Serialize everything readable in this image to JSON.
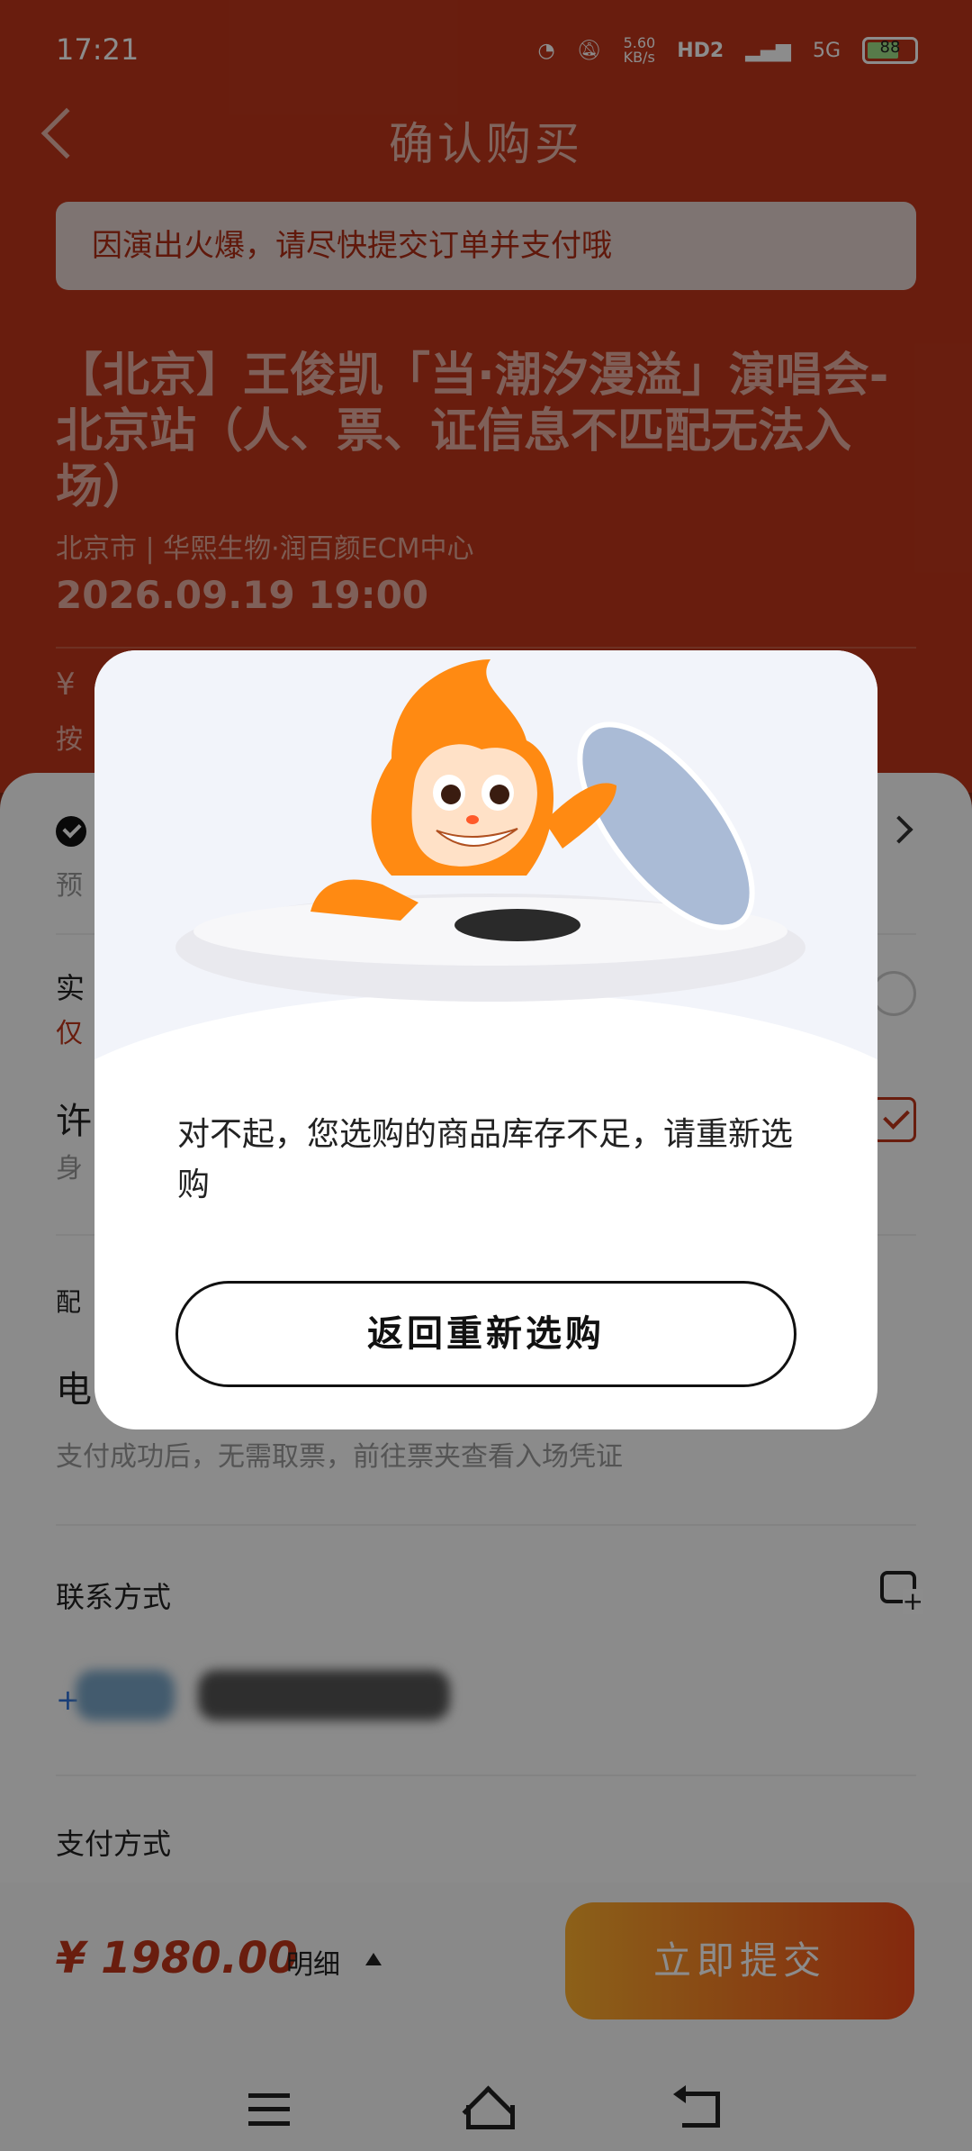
{
  "status": {
    "time": "17:21",
    "net_speed": "5.60\nKB/s",
    "hd": "HD2",
    "signal": "5G",
    "battery": "88"
  },
  "header": {
    "title": "确认购买"
  },
  "notice": "因演出火爆，请尽快提交订单并支付哦",
  "event": {
    "title": "【北京】王俊凯「当·潮汐漫溢」演唱会-北京站（人、票、证信息不匹配无法入场）",
    "venue": "北京市 | 华熙生物·润百颜ECM中心",
    "datetime": "2026.09.19 19:00",
    "price_peek": "¥",
    "price_sub_peek": "按"
  },
  "sheet": {
    "line1_prefix": "预",
    "row_real_name_label": "实",
    "row_real_name_sub": "仅",
    "row_buyer_name": "许",
    "row_buyer_sub": "身",
    "delivery_label": "配",
    "delivery_value": "电",
    "delivery_desc": "支付成功后，无需取票，前往票夹查看入场凭证",
    "contact_label": "联系方式",
    "contact_prefix": "+",
    "payment_label": "支付方式"
  },
  "footer": {
    "total": "¥ 1980.00",
    "detail": "明细",
    "submit": "立即提交"
  },
  "modal": {
    "message": "对不起，您选购的商品库存不足，请重新选购",
    "button": "返回重新选购"
  },
  "colors": {
    "brand": "#c0361b",
    "submit_start": "#ffb02e",
    "submit_end": "#f04a1a"
  },
  "icons": [
    "back-icon",
    "check-icon",
    "chevron-right-icon",
    "checkbox-icon",
    "radio-icon",
    "edit-contact-icon",
    "menu-icon",
    "home-icon",
    "back-nav-icon",
    "mascot-illustration"
  ]
}
